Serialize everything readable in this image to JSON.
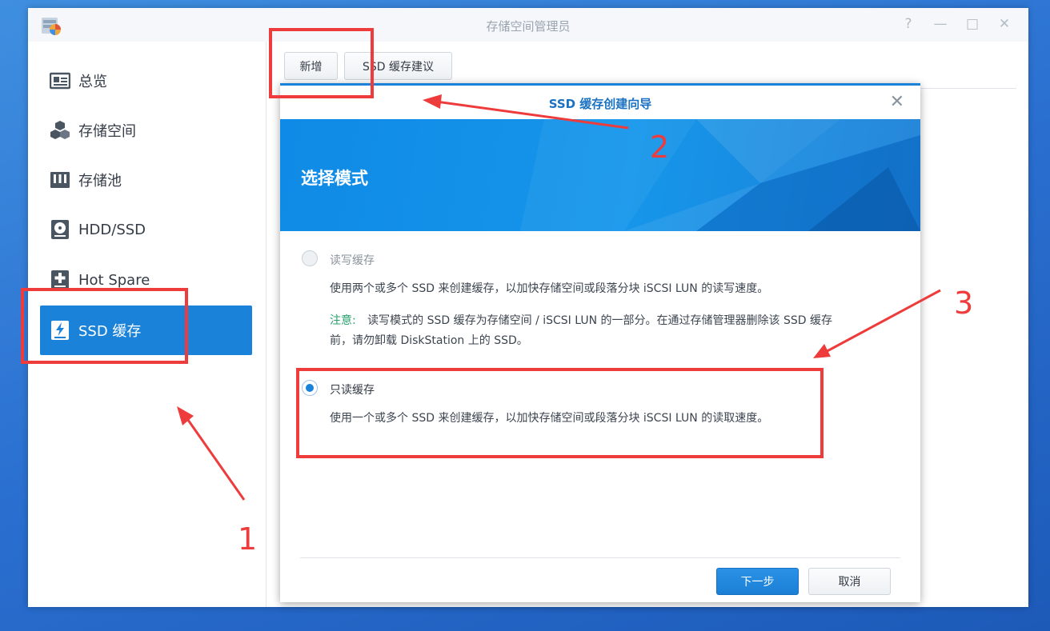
{
  "window": {
    "title": "存储空间管理员",
    "controls": [
      "?",
      "—",
      "□",
      "✕"
    ]
  },
  "sidebar": {
    "items": [
      {
        "label": "总览",
        "icon": "overview-icon",
        "active": false
      },
      {
        "label": "存储空间",
        "icon": "cubes-icon",
        "active": false
      },
      {
        "label": "存储池",
        "icon": "storage-pool-icon",
        "active": false
      },
      {
        "label": "HDD/SSD",
        "icon": "disk-icon",
        "active": false
      },
      {
        "label": "Hot Spare",
        "icon": "plus-box-icon",
        "active": false
      },
      {
        "label": "SSD 缓存",
        "icon": "flash-icon",
        "active": true
      }
    ]
  },
  "toolbar": {
    "add_label": "新增",
    "advice_label": "SSD 缓存建议"
  },
  "dialog": {
    "title": "SSD 缓存创建向导",
    "banner_title": "选择模式",
    "options": [
      {
        "label": "读写缓存",
        "selected": false,
        "disabled": true,
        "description": "使用两个或多个 SSD 来创建缓存，以加快存储空间或段落分块 iSCSI LUN 的读写速度。",
        "note_label": "注意:",
        "note_line1": "读写模式的 SSD 缓存为存储空间 / iSCSI LUN 的一部分。在通过存储管理器删除该 SSD 缓存",
        "note_line2": "前，请勿卸载 DiskStation 上的 SSD。"
      },
      {
        "label": "只读缓存",
        "selected": true,
        "disabled": false,
        "description": "使用一个或多个 SSD 来创建缓存，以加快存储空间或段落分块 iSCSI LUN 的读取速度。"
      }
    ],
    "next_label": "下一步",
    "cancel_label": "取消"
  },
  "annotations": {
    "numbers": [
      "1",
      "2",
      "3"
    ],
    "color": "#ee3b3b"
  },
  "colors": {
    "accent": "#1b82d9",
    "note": "#27a06a"
  }
}
